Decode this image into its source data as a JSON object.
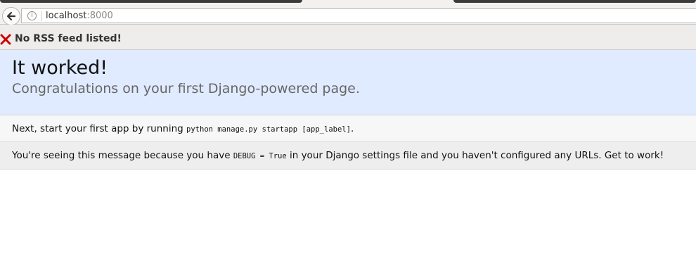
{
  "browser": {
    "url_host": "localhost",
    "url_port": ":8000"
  },
  "notice": {
    "text": "No RSS feed listed!"
  },
  "summary": {
    "title": "It worked!",
    "subtitle": "Congratulations on your first Django-powered page."
  },
  "instructions": {
    "prefix": "Next, start your first app by running",
    "command": "python manage.py startapp [app_label]",
    "suffix": "."
  },
  "explanation": {
    "prefix": "You're seeing this message because you have",
    "code": "DEBUG = True",
    "suffix": "in your Django settings file and you haven't configured any URLs. Get to work!"
  },
  "colors": {
    "summary_bg": "#e0ebff",
    "notice_icon": "#cc0000"
  }
}
